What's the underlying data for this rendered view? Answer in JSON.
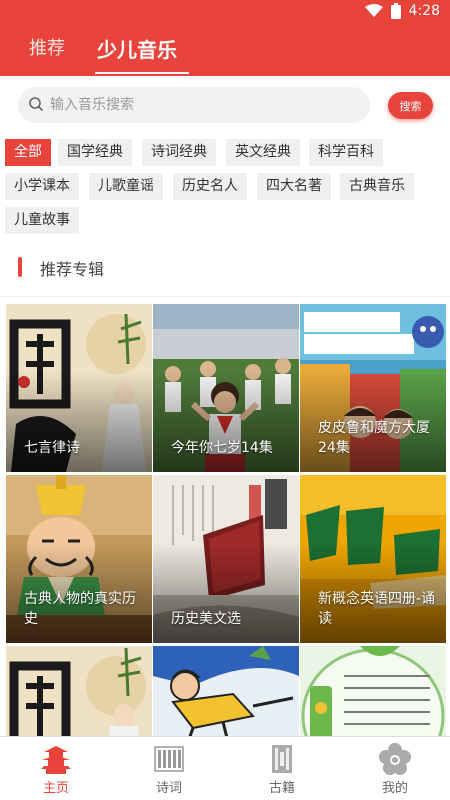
{
  "status_bar": {
    "time": "4:28"
  },
  "header_tabs": [
    {
      "label": "推荐",
      "active": false
    },
    {
      "label": "少儿音乐",
      "active": true
    }
  ],
  "search": {
    "placeholder": "输入音乐搜索",
    "button": "搜索"
  },
  "categories": [
    "全部",
    "国学经典",
    "诗词经典",
    "英文经典",
    "科学百科",
    "小学课本",
    "儿歌童谣",
    "历史名人",
    "四大名著",
    "古典音乐",
    "儿童故事"
  ],
  "selected_category": "全部",
  "section": {
    "title": "推荐专辑"
  },
  "albums": [
    {
      "title": "七言律诗",
      "art": "guoxue-calligraphy"
    },
    {
      "title": "今年你七岁14集",
      "art": "school-children"
    },
    {
      "title": "皮皮鲁和魔方大厦24集",
      "art": "pipilu-cover"
    },
    {
      "title": "古典人物的真实历史",
      "art": "cartoon-scholar"
    },
    {
      "title": "历史美文选",
      "art": "book-cover"
    },
    {
      "title": "新概念英语四册-诵读",
      "art": "new-concept-english"
    },
    {
      "title": "",
      "art": "guoxue-calligraphy"
    },
    {
      "title": "",
      "art": "cartoon-kid-flying"
    },
    {
      "title": "",
      "art": "poem-scroll"
    }
  ],
  "bottom_nav": [
    {
      "label": "主页",
      "icon": "pagoda-icon",
      "active": true
    },
    {
      "label": "诗词",
      "icon": "bamboo-scroll-icon",
      "active": false
    },
    {
      "label": "古籍",
      "icon": "ancient-book-icon",
      "active": false
    },
    {
      "label": "我的",
      "icon": "flower-profile-icon",
      "active": false
    }
  ],
  "colors": {
    "accent": "#e8443b",
    "inactive": "#999999"
  }
}
